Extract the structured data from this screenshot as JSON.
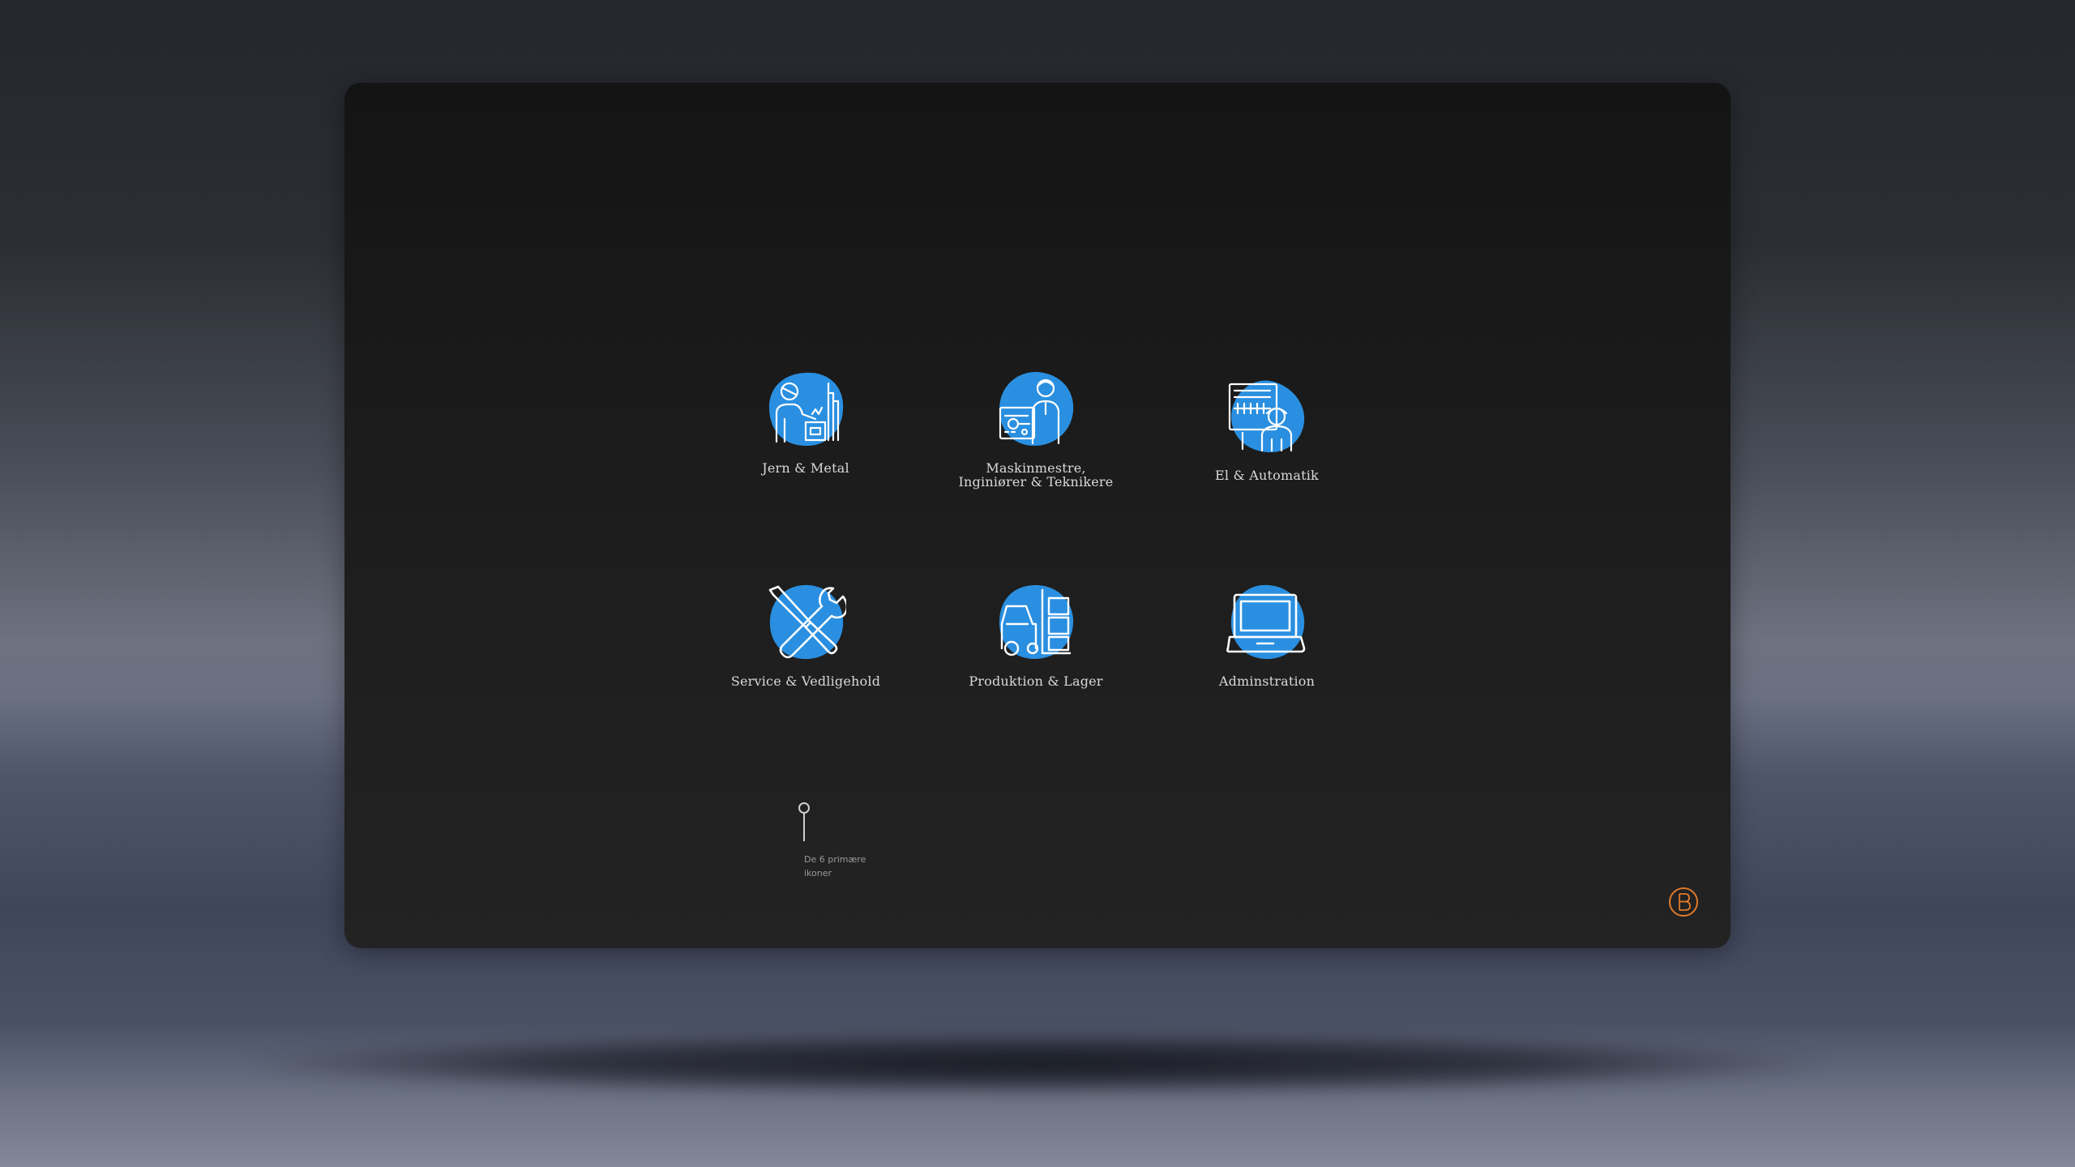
{
  "items": [
    {
      "label": "Jern & Metal",
      "icon": "welder-icon"
    },
    {
      "label": "Maskinmestre,\nInginiører & Teknikere",
      "icon": "engineer-control-panel-icon"
    },
    {
      "label": "El & Automatik",
      "icon": "electrician-panel-icon"
    },
    {
      "label": "Service & Vedligehold",
      "icon": "wrench-screwdriver-icon"
    },
    {
      "label": "Produktion & Lager",
      "icon": "forklift-icon"
    },
    {
      "label": "Adminstration",
      "icon": "laptop-icon"
    }
  ],
  "annotation": {
    "text": "De 6 primære ikoner"
  },
  "colors": {
    "accent_blue": "#2a8fe0",
    "logo_orange": "#e07a2a",
    "screen": "#1e1e1e"
  }
}
